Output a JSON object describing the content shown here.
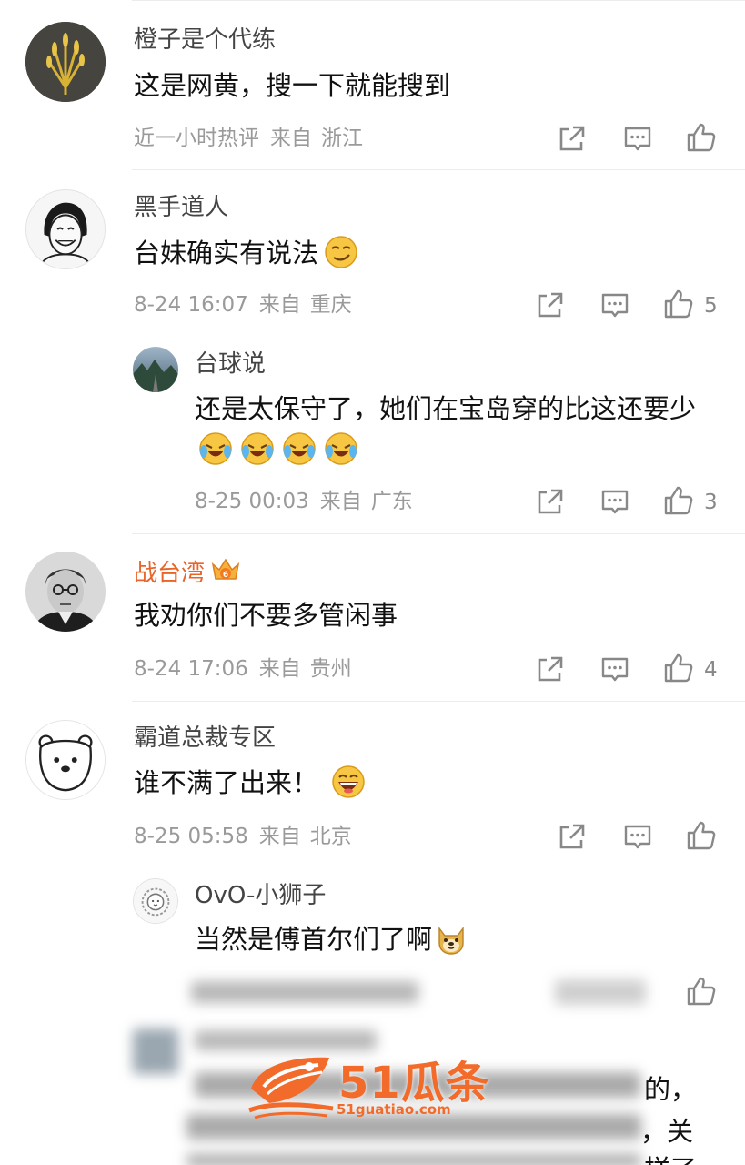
{
  "comments": [
    {
      "user": "橙子是个代练",
      "text": "这是网黄，搜一下就能搜到",
      "time": "近一小时热评",
      "from_label": "来自",
      "location": "浙江",
      "likes": ""
    },
    {
      "user": "黑手道人",
      "text": "台妹确实有说法",
      "emoji": "smirk-emoji",
      "time": "8-24 16:07",
      "from_label": "来自",
      "location": "重庆",
      "likes": "5"
    },
    {
      "user": "台球说",
      "text": "还是太保守了，她们在宝岛穿的比这还要少",
      "emoji": "laugh-cry-emoji",
      "time": "8-25 00:03",
      "from_label": "来自",
      "location": "广东",
      "likes": "3",
      "is_reply": true
    },
    {
      "user": "战台湾",
      "badge": "crown-badge-icon",
      "text": "我劝你们不要多管闲事",
      "time": "8-24 17:06",
      "from_label": "来自",
      "location": "贵州",
      "likes": "4"
    },
    {
      "user": "霸道总裁专区",
      "text": "谁不满了出来！",
      "emoji": "grin-emoji",
      "time": "8-25 05:58",
      "from_label": "来自",
      "location": "北京",
      "likes": ""
    },
    {
      "user": "OvO-小狮子",
      "text": "当然是傅首尔们了啊",
      "emoji": "doge-emoji",
      "is_reply": true
    }
  ],
  "blurred_tail": {
    "line1_end": "的，",
    "line2_end": "，关",
    "line3_end": "样了"
  },
  "watermark": {
    "brand": "51瓜条",
    "url": "51guatiao.com"
  },
  "icons": {
    "share": "share-icon",
    "reply": "comment-icon",
    "like": "thumbs-up-icon"
  },
  "colors": {
    "vip_name": "#e8652a",
    "meta": "#9a9a9a",
    "watermark": "#f26b2a"
  }
}
